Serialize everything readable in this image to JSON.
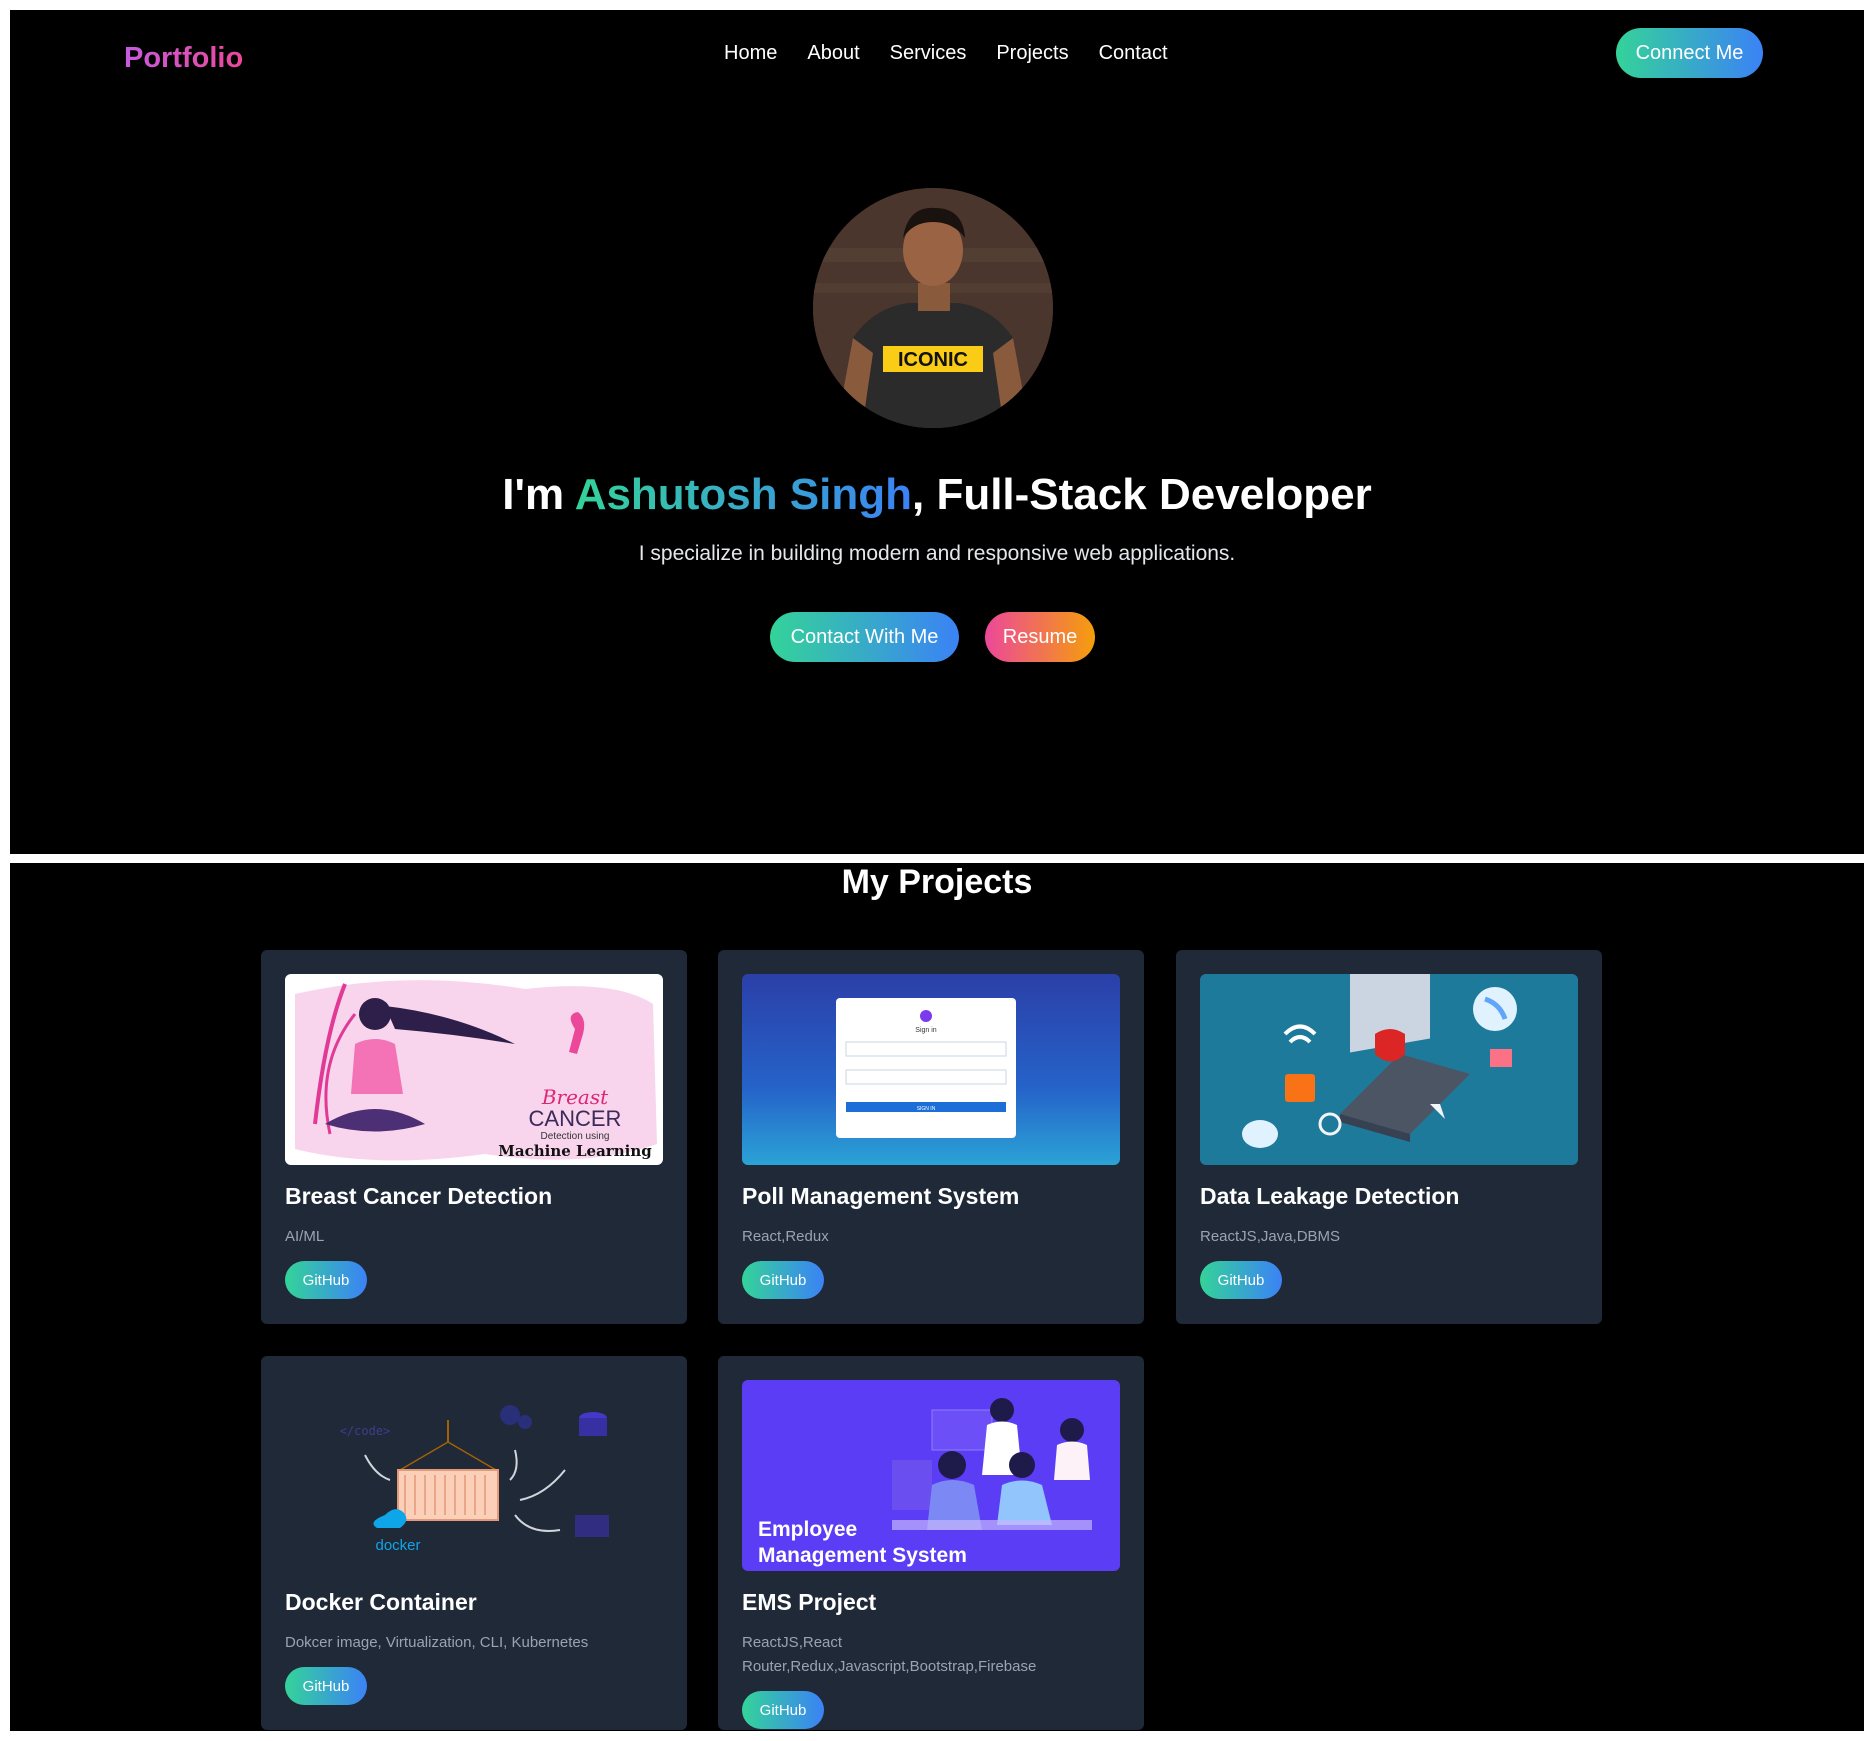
{
  "nav": {
    "brand": "Portfolio",
    "links": [
      "Home",
      "About",
      "Services",
      "Projects",
      "Contact"
    ],
    "connect_label": "Connect Me"
  },
  "hero": {
    "title_prefix": "I'm ",
    "name": "Ashutosh Singh",
    "title_suffix": ", Full-Stack Developer",
    "shirt_text": "ICONIC",
    "subtitle": "I specialize in building modern and responsive web applications.",
    "contact_label": "Contact With Me",
    "resume_label": "Resume"
  },
  "projects": {
    "heading": "My Projects",
    "items": [
      {
        "title": "Breast Cancer Detection",
        "tags": "AI/ML",
        "github_label": "GitHub",
        "thumb": {
          "l1": "Breast",
          "l2": "CANCER",
          "l3": "Detection using",
          "l4": "Machine Learning"
        }
      },
      {
        "title": "Poll Management System",
        "tags": "React,Redux",
        "github_label": "GitHub",
        "thumb": {
          "signin": "Sign in",
          "button": "SIGN IN"
        }
      },
      {
        "title": "Data Leakage Detection",
        "tags": "ReactJS,Java,DBMS",
        "github_label": "GitHub"
      },
      {
        "title": "Docker Container",
        "tags": "Dokcer image, Virtualization, CLI, Kubernetes",
        "github_label": "GitHub",
        "thumb": {
          "code": "</code>",
          "docker": "docker"
        }
      },
      {
        "title": "EMS Project",
        "tags": "ReactJS,React Router,Redux,Javascript,Bootstrap,Firebase",
        "github_label": "GitHub",
        "thumb": {
          "l1": "Employee",
          "l2": "Management System"
        }
      }
    ]
  },
  "colors": {
    "accent_green": "#34d399",
    "accent_blue": "#3b82f6",
    "accent_pink": "#ec4899",
    "accent_orange": "#f59e0b",
    "card_bg": "#1f2937"
  }
}
